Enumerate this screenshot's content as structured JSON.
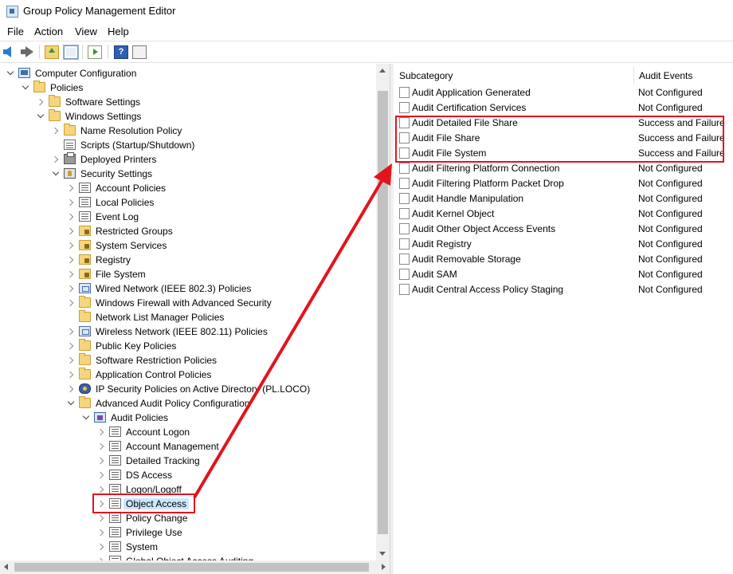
{
  "window": {
    "title": "Group Policy Management Editor"
  },
  "menu": [
    "File",
    "Action",
    "View",
    "Help"
  ],
  "toolbar": {
    "back": "back-icon",
    "forward": "forward-icon",
    "up": "up-folder-icon",
    "show_hide": "show-hide-tree-icon",
    "export": "export-list-icon",
    "help": "help-icon",
    "view": "view-icon"
  },
  "tree": [
    {
      "label": "Computer Configuration",
      "icon": "computer",
      "state": "expanded"
    },
    {
      "label": "Policies",
      "icon": "folder",
      "state": "expanded"
    },
    {
      "label": "Software Settings",
      "icon": "folder",
      "state": "collapsed"
    },
    {
      "label": "Windows Settings",
      "icon": "folder",
      "state": "expanded"
    },
    {
      "label": "Name Resolution Policy",
      "icon": "folder",
      "state": "collapsed"
    },
    {
      "label": "Scripts (Startup/Shutdown)",
      "icon": "script",
      "state": "none"
    },
    {
      "label": "Deployed Printers",
      "icon": "printer",
      "state": "collapsed"
    },
    {
      "label": "Security Settings",
      "icon": "security",
      "state": "expanded"
    },
    {
      "label": "Account Policies",
      "icon": "policy",
      "state": "collapsed"
    },
    {
      "label": "Local Policies",
      "icon": "policy",
      "state": "collapsed"
    },
    {
      "label": "Event Log",
      "icon": "policy",
      "state": "collapsed"
    },
    {
      "label": "Restricted Groups",
      "icon": "lockfolder",
      "state": "collapsed"
    },
    {
      "label": "System Services",
      "icon": "lockfolder",
      "state": "collapsed"
    },
    {
      "label": "Registry",
      "icon": "lockfolder",
      "state": "collapsed"
    },
    {
      "label": "File System",
      "icon": "lockfolder",
      "state": "collapsed"
    },
    {
      "label": "Wired Network (IEEE 802.3) Policies",
      "icon": "network",
      "state": "collapsed"
    },
    {
      "label": "Windows Firewall with Advanced Security",
      "icon": "folder",
      "state": "collapsed"
    },
    {
      "label": "Network List Manager Policies",
      "icon": "folder",
      "state": "none"
    },
    {
      "label": "Wireless Network (IEEE 802.11) Policies",
      "icon": "network",
      "state": "collapsed"
    },
    {
      "label": "Public Key Policies",
      "icon": "folder",
      "state": "collapsed"
    },
    {
      "label": "Software Restriction Policies",
      "icon": "folder",
      "state": "collapsed"
    },
    {
      "label": "Application Control Policies",
      "icon": "folder",
      "state": "collapsed"
    },
    {
      "label": "IP Security Policies on Active Directory (PL.LOCO)",
      "icon": "ipsec",
      "state": "collapsed"
    },
    {
      "label": "Advanced Audit Policy Configuration",
      "icon": "folder",
      "state": "expanded"
    },
    {
      "label": "Audit Policies",
      "icon": "audit",
      "state": "expanded"
    },
    {
      "label": "Account Logon",
      "icon": "policy",
      "state": "collapsed"
    },
    {
      "label": "Account Management",
      "icon": "policy",
      "state": "collapsed"
    },
    {
      "label": "Detailed Tracking",
      "icon": "policy",
      "state": "collapsed"
    },
    {
      "label": "DS Access",
      "icon": "policy",
      "state": "collapsed"
    },
    {
      "label": "Logon/Logoff",
      "icon": "policy",
      "state": "collapsed"
    },
    {
      "label": "Object Access",
      "icon": "policy",
      "state": "collapsed",
      "selected": true
    },
    {
      "label": "Policy Change",
      "icon": "policy",
      "state": "collapsed"
    },
    {
      "label": "Privilege Use",
      "icon": "policy",
      "state": "collapsed"
    },
    {
      "label": "System",
      "icon": "policy",
      "state": "collapsed"
    },
    {
      "label": "Global Object Access Auditing",
      "icon": "policy",
      "state": "collapsed"
    }
  ],
  "list": {
    "columns": [
      "Subcategory",
      "Audit Events"
    ],
    "rows": [
      {
        "name": "Audit Application Generated",
        "value": "Not Configured"
      },
      {
        "name": "Audit Certification Services",
        "value": "Not Configured"
      },
      {
        "name": "Audit Detailed File Share",
        "value": "Success and Failure"
      },
      {
        "name": "Audit File Share",
        "value": "Success and Failure"
      },
      {
        "name": "Audit File System",
        "value": "Success and Failure"
      },
      {
        "name": "Audit Filtering Platform Connection",
        "value": "Not Configured"
      },
      {
        "name": "Audit Filtering Platform Packet Drop",
        "value": "Not Configured"
      },
      {
        "name": "Audit Handle Manipulation",
        "value": "Not Configured"
      },
      {
        "name": "Audit Kernel Object",
        "value": "Not Configured"
      },
      {
        "name": "Audit Other Object Access Events",
        "value": "Not Configured"
      },
      {
        "name": "Audit Registry",
        "value": "Not Configured"
      },
      {
        "name": "Audit Removable Storage",
        "value": "Not Configured"
      },
      {
        "name": "Audit SAM",
        "value": "Not Configured"
      },
      {
        "name": "Audit Central Access Policy Staging",
        "value": "Not Configured"
      }
    ]
  },
  "annotation_color": "#e3131b"
}
